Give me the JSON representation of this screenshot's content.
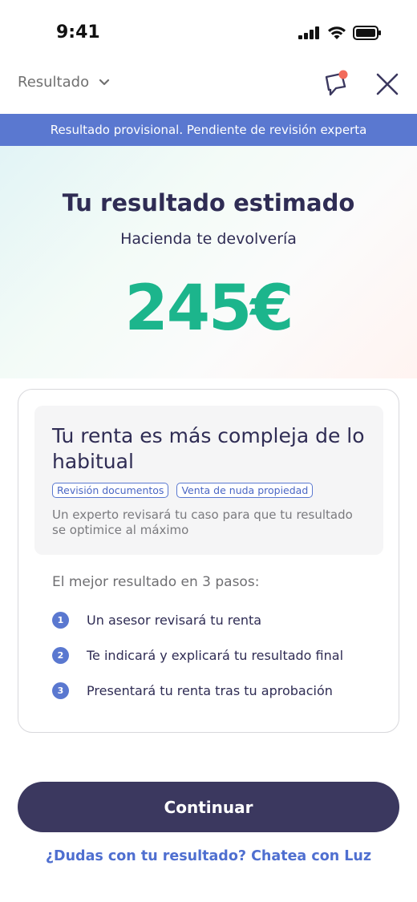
{
  "status_bar": {
    "time": "9:41"
  },
  "topbar": {
    "selector_label": "Resultado"
  },
  "banner": {
    "text": "Resultado provisional. Pendiente de revisión experta"
  },
  "hero": {
    "title": "Tu resultado estimado",
    "subtitle": "Hacienda te devolvería",
    "amount": "245€"
  },
  "card": {
    "title": "Tu renta es más compleja de lo habitual",
    "tags": [
      "Revisión documentos",
      "Venta de nuda propiedad"
    ],
    "description": "Un experto revisará tu caso para que tu resultado se optimice al máximo",
    "steps_title": "El mejor resultado en 3 pasos:",
    "steps": [
      {
        "num": "1",
        "text": "Un asesor revisará tu renta"
      },
      {
        "num": "2",
        "text": "Te indicará y explicará tu resultado final"
      },
      {
        "num": "3",
        "text": "Presentará tu renta tras tu aprobación"
      }
    ]
  },
  "actions": {
    "continue_label": "Continuar",
    "help_link": "¿Dudas con tu resultado? Chatea con Luz"
  },
  "colors": {
    "accent": "#5a78d0",
    "amount": "#1cb58c",
    "primary_button": "#3b385f",
    "notification_dot": "#f26b5b"
  }
}
